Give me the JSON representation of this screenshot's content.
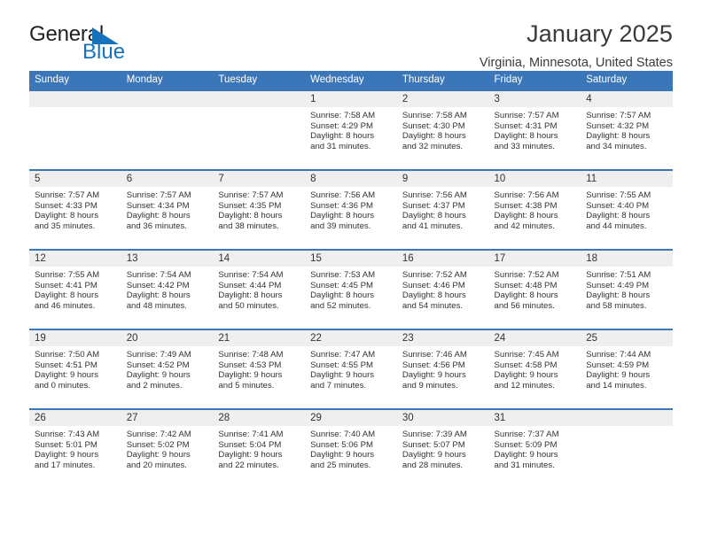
{
  "brand": {
    "word_one": "General",
    "word_two": "Blue",
    "color_primary": "#1673bb",
    "color_text": "#231f20",
    "triangle_icon": "triangle-icon"
  },
  "header": {
    "title": "January 2025",
    "subtitle": "Virginia, Minnesota, United States",
    "header_bg": "#3b77b8",
    "header_text": "#ffffff",
    "daynum_bg": "#efefef"
  },
  "weekday_headers": [
    "Sunday",
    "Monday",
    "Tuesday",
    "Wednesday",
    "Thursday",
    "Friday",
    "Saturday"
  ],
  "labels": {
    "sunrise": "Sunrise:",
    "sunset": "Sunset:",
    "daylight": "Daylight:"
  },
  "weeks": [
    [
      {
        "empty": true
      },
      {
        "empty": true
      },
      {
        "empty": true
      },
      {
        "day": "1",
        "sunrise": "Sunrise: 7:58 AM",
        "sunset": "Sunset: 4:29 PM",
        "daylight_1": "Daylight: 8 hours",
        "daylight_2": "and 31 minutes."
      },
      {
        "day": "2",
        "sunrise": "Sunrise: 7:58 AM",
        "sunset": "Sunset: 4:30 PM",
        "daylight_1": "Daylight: 8 hours",
        "daylight_2": "and 32 minutes."
      },
      {
        "day": "3",
        "sunrise": "Sunrise: 7:57 AM",
        "sunset": "Sunset: 4:31 PM",
        "daylight_1": "Daylight: 8 hours",
        "daylight_2": "and 33 minutes."
      },
      {
        "day": "4",
        "sunrise": "Sunrise: 7:57 AM",
        "sunset": "Sunset: 4:32 PM",
        "daylight_1": "Daylight: 8 hours",
        "daylight_2": "and 34 minutes."
      }
    ],
    [
      {
        "day": "5",
        "sunrise": "Sunrise: 7:57 AM",
        "sunset": "Sunset: 4:33 PM",
        "daylight_1": "Daylight: 8 hours",
        "daylight_2": "and 35 minutes."
      },
      {
        "day": "6",
        "sunrise": "Sunrise: 7:57 AM",
        "sunset": "Sunset: 4:34 PM",
        "daylight_1": "Daylight: 8 hours",
        "daylight_2": "and 36 minutes."
      },
      {
        "day": "7",
        "sunrise": "Sunrise: 7:57 AM",
        "sunset": "Sunset: 4:35 PM",
        "daylight_1": "Daylight: 8 hours",
        "daylight_2": "and 38 minutes."
      },
      {
        "day": "8",
        "sunrise": "Sunrise: 7:56 AM",
        "sunset": "Sunset: 4:36 PM",
        "daylight_1": "Daylight: 8 hours",
        "daylight_2": "and 39 minutes."
      },
      {
        "day": "9",
        "sunrise": "Sunrise: 7:56 AM",
        "sunset": "Sunset: 4:37 PM",
        "daylight_1": "Daylight: 8 hours",
        "daylight_2": "and 41 minutes."
      },
      {
        "day": "10",
        "sunrise": "Sunrise: 7:56 AM",
        "sunset": "Sunset: 4:38 PM",
        "daylight_1": "Daylight: 8 hours",
        "daylight_2": "and 42 minutes."
      },
      {
        "day": "11",
        "sunrise": "Sunrise: 7:55 AM",
        "sunset": "Sunset: 4:40 PM",
        "daylight_1": "Daylight: 8 hours",
        "daylight_2": "and 44 minutes."
      }
    ],
    [
      {
        "day": "12",
        "sunrise": "Sunrise: 7:55 AM",
        "sunset": "Sunset: 4:41 PM",
        "daylight_1": "Daylight: 8 hours",
        "daylight_2": "and 46 minutes."
      },
      {
        "day": "13",
        "sunrise": "Sunrise: 7:54 AM",
        "sunset": "Sunset: 4:42 PM",
        "daylight_1": "Daylight: 8 hours",
        "daylight_2": "and 48 minutes."
      },
      {
        "day": "14",
        "sunrise": "Sunrise: 7:54 AM",
        "sunset": "Sunset: 4:44 PM",
        "daylight_1": "Daylight: 8 hours",
        "daylight_2": "and 50 minutes."
      },
      {
        "day": "15",
        "sunrise": "Sunrise: 7:53 AM",
        "sunset": "Sunset: 4:45 PM",
        "daylight_1": "Daylight: 8 hours",
        "daylight_2": "and 52 minutes."
      },
      {
        "day": "16",
        "sunrise": "Sunrise: 7:52 AM",
        "sunset": "Sunset: 4:46 PM",
        "daylight_1": "Daylight: 8 hours",
        "daylight_2": "and 54 minutes."
      },
      {
        "day": "17",
        "sunrise": "Sunrise: 7:52 AM",
        "sunset": "Sunset: 4:48 PM",
        "daylight_1": "Daylight: 8 hours",
        "daylight_2": "and 56 minutes."
      },
      {
        "day": "18",
        "sunrise": "Sunrise: 7:51 AM",
        "sunset": "Sunset: 4:49 PM",
        "daylight_1": "Daylight: 8 hours",
        "daylight_2": "and 58 minutes."
      }
    ],
    [
      {
        "day": "19",
        "sunrise": "Sunrise: 7:50 AM",
        "sunset": "Sunset: 4:51 PM",
        "daylight_1": "Daylight: 9 hours",
        "daylight_2": "and 0 minutes."
      },
      {
        "day": "20",
        "sunrise": "Sunrise: 7:49 AM",
        "sunset": "Sunset: 4:52 PM",
        "daylight_1": "Daylight: 9 hours",
        "daylight_2": "and 2 minutes."
      },
      {
        "day": "21",
        "sunrise": "Sunrise: 7:48 AM",
        "sunset": "Sunset: 4:53 PM",
        "daylight_1": "Daylight: 9 hours",
        "daylight_2": "and 5 minutes."
      },
      {
        "day": "22",
        "sunrise": "Sunrise: 7:47 AM",
        "sunset": "Sunset: 4:55 PM",
        "daylight_1": "Daylight: 9 hours",
        "daylight_2": "and 7 minutes."
      },
      {
        "day": "23",
        "sunrise": "Sunrise: 7:46 AM",
        "sunset": "Sunset: 4:56 PM",
        "daylight_1": "Daylight: 9 hours",
        "daylight_2": "and 9 minutes."
      },
      {
        "day": "24",
        "sunrise": "Sunrise: 7:45 AM",
        "sunset": "Sunset: 4:58 PM",
        "daylight_1": "Daylight: 9 hours",
        "daylight_2": "and 12 minutes."
      },
      {
        "day": "25",
        "sunrise": "Sunrise: 7:44 AM",
        "sunset": "Sunset: 4:59 PM",
        "daylight_1": "Daylight: 9 hours",
        "daylight_2": "and 14 minutes."
      }
    ],
    [
      {
        "day": "26",
        "sunrise": "Sunrise: 7:43 AM",
        "sunset": "Sunset: 5:01 PM",
        "daylight_1": "Daylight: 9 hours",
        "daylight_2": "and 17 minutes."
      },
      {
        "day": "27",
        "sunrise": "Sunrise: 7:42 AM",
        "sunset": "Sunset: 5:02 PM",
        "daylight_1": "Daylight: 9 hours",
        "daylight_2": "and 20 minutes."
      },
      {
        "day": "28",
        "sunrise": "Sunrise: 7:41 AM",
        "sunset": "Sunset: 5:04 PM",
        "daylight_1": "Daylight: 9 hours",
        "daylight_2": "and 22 minutes."
      },
      {
        "day": "29",
        "sunrise": "Sunrise: 7:40 AM",
        "sunset": "Sunset: 5:06 PM",
        "daylight_1": "Daylight: 9 hours",
        "daylight_2": "and 25 minutes."
      },
      {
        "day": "30",
        "sunrise": "Sunrise: 7:39 AM",
        "sunset": "Sunset: 5:07 PM",
        "daylight_1": "Daylight: 9 hours",
        "daylight_2": "and 28 minutes."
      },
      {
        "day": "31",
        "sunrise": "Sunrise: 7:37 AM",
        "sunset": "Sunset: 5:09 PM",
        "daylight_1": "Daylight: 9 hours",
        "daylight_2": "and 31 minutes."
      },
      {
        "empty": true
      }
    ]
  ]
}
